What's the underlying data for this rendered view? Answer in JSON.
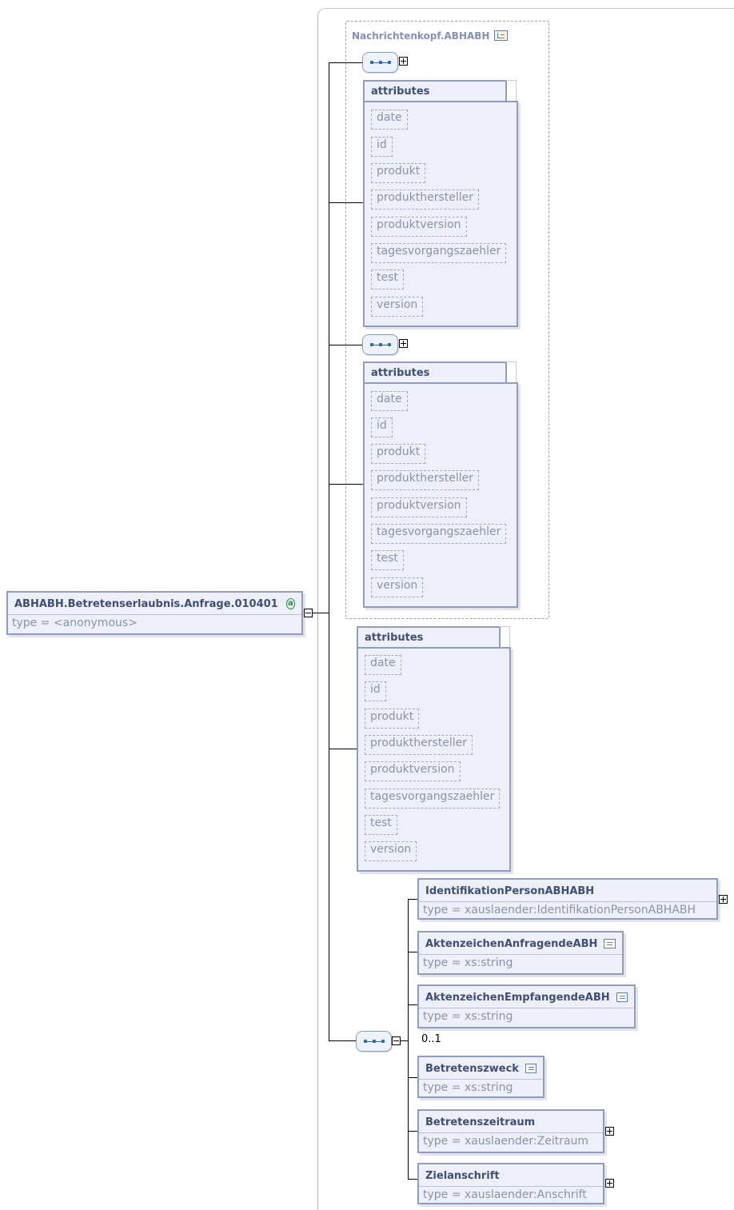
{
  "root": {
    "name": "ABHABH.Betretenserlaubnis.Anfrage.010401",
    "type": "type = <anonymous>",
    "badge": "a"
  },
  "group": {
    "title": "Nachrichtenkopf.ABHABH"
  },
  "attributes_label": "attributes",
  "attribute_names": [
    "date",
    "id",
    "produkt",
    "produkthersteller",
    "produktversion",
    "tagesvorgangszaehler",
    "test",
    "version"
  ],
  "children": [
    {
      "name": "IdentifikationPersonABHABH",
      "type": "type = xauslaender:IdentifikationPersonABHABH"
    },
    {
      "name": "AktenzeichenAnfragendeABH",
      "type": "type = xs:string"
    },
    {
      "name": "AktenzeichenEmpfangendeABH",
      "type": "type = xs:string"
    },
    {
      "name": "Betretenszweck",
      "type": "type = xs:string"
    },
    {
      "name": "Betretenszeitraum",
      "type": "type = xauslaender:Zeitraum"
    },
    {
      "name": "Zielanschrift",
      "type": "type = xauslaender:Anschrift"
    }
  ],
  "occurrence": "0..1",
  "colors": {
    "box_fill": "#edf0f9",
    "box_border": "#919db8",
    "title_text": "#3f4f74",
    "muted_text": "#8a93a7",
    "badge_green": "#2e8b3e"
  },
  "icons": [
    "sequence-icon",
    "expand-icon",
    "collapse-icon",
    "documentation-icon",
    "attribute-group-icon",
    "attribute-badge-icon"
  ]
}
